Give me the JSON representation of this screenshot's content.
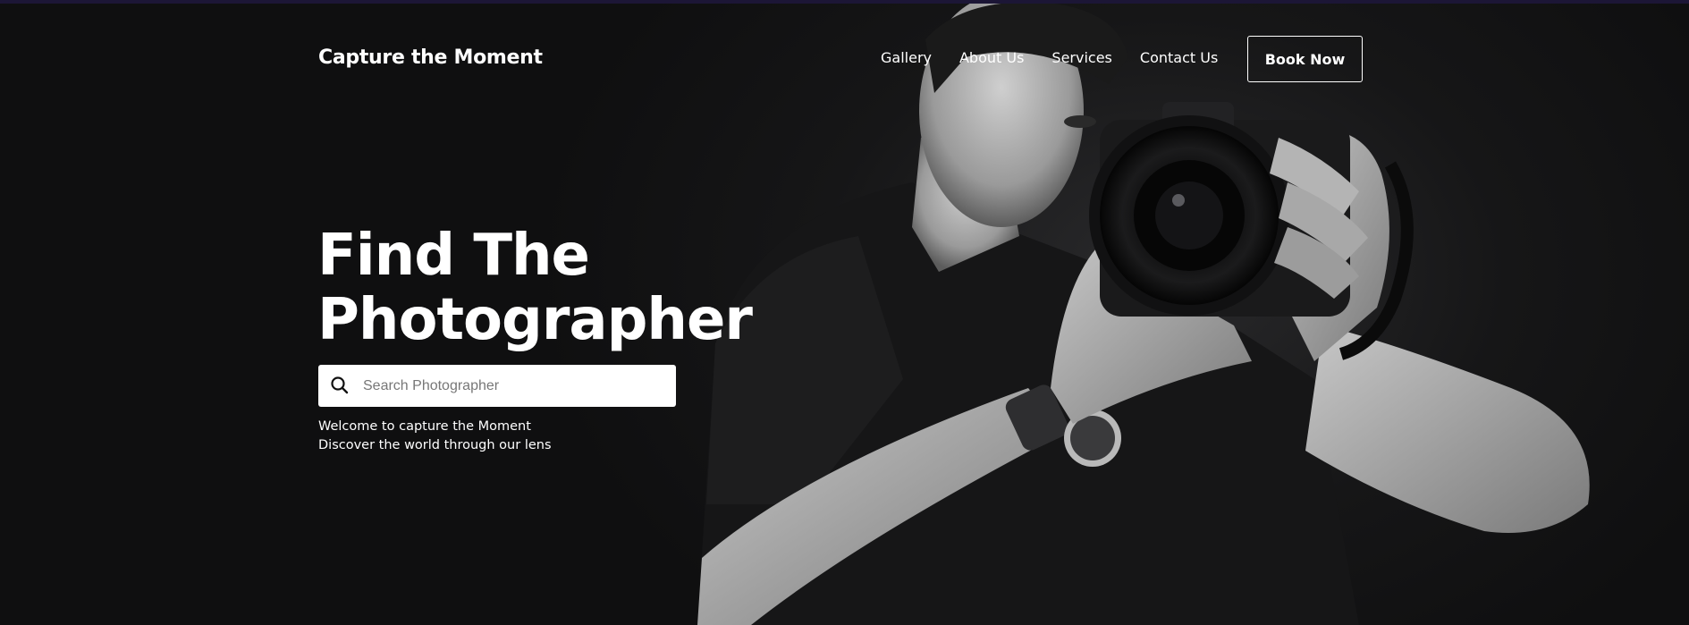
{
  "header": {
    "brand": "Capture the Moment",
    "nav": [
      "Gallery",
      "About Us",
      "Services",
      "Contact Us"
    ],
    "cta": "Book Now"
  },
  "hero": {
    "headline_line1": "Find The",
    "headline_line2": "Photographer",
    "search": {
      "placeholder": "Search Photographer",
      "value": "",
      "icon": "search-icon"
    },
    "tagline_line1": "Welcome to capture the Moment",
    "tagline_line2": "Discover the world through our lens",
    "image": "photographer-with-camera"
  },
  "colors": {
    "background": "#0f0f10",
    "text": "#ffffff",
    "accent_line": "#1c1636"
  }
}
